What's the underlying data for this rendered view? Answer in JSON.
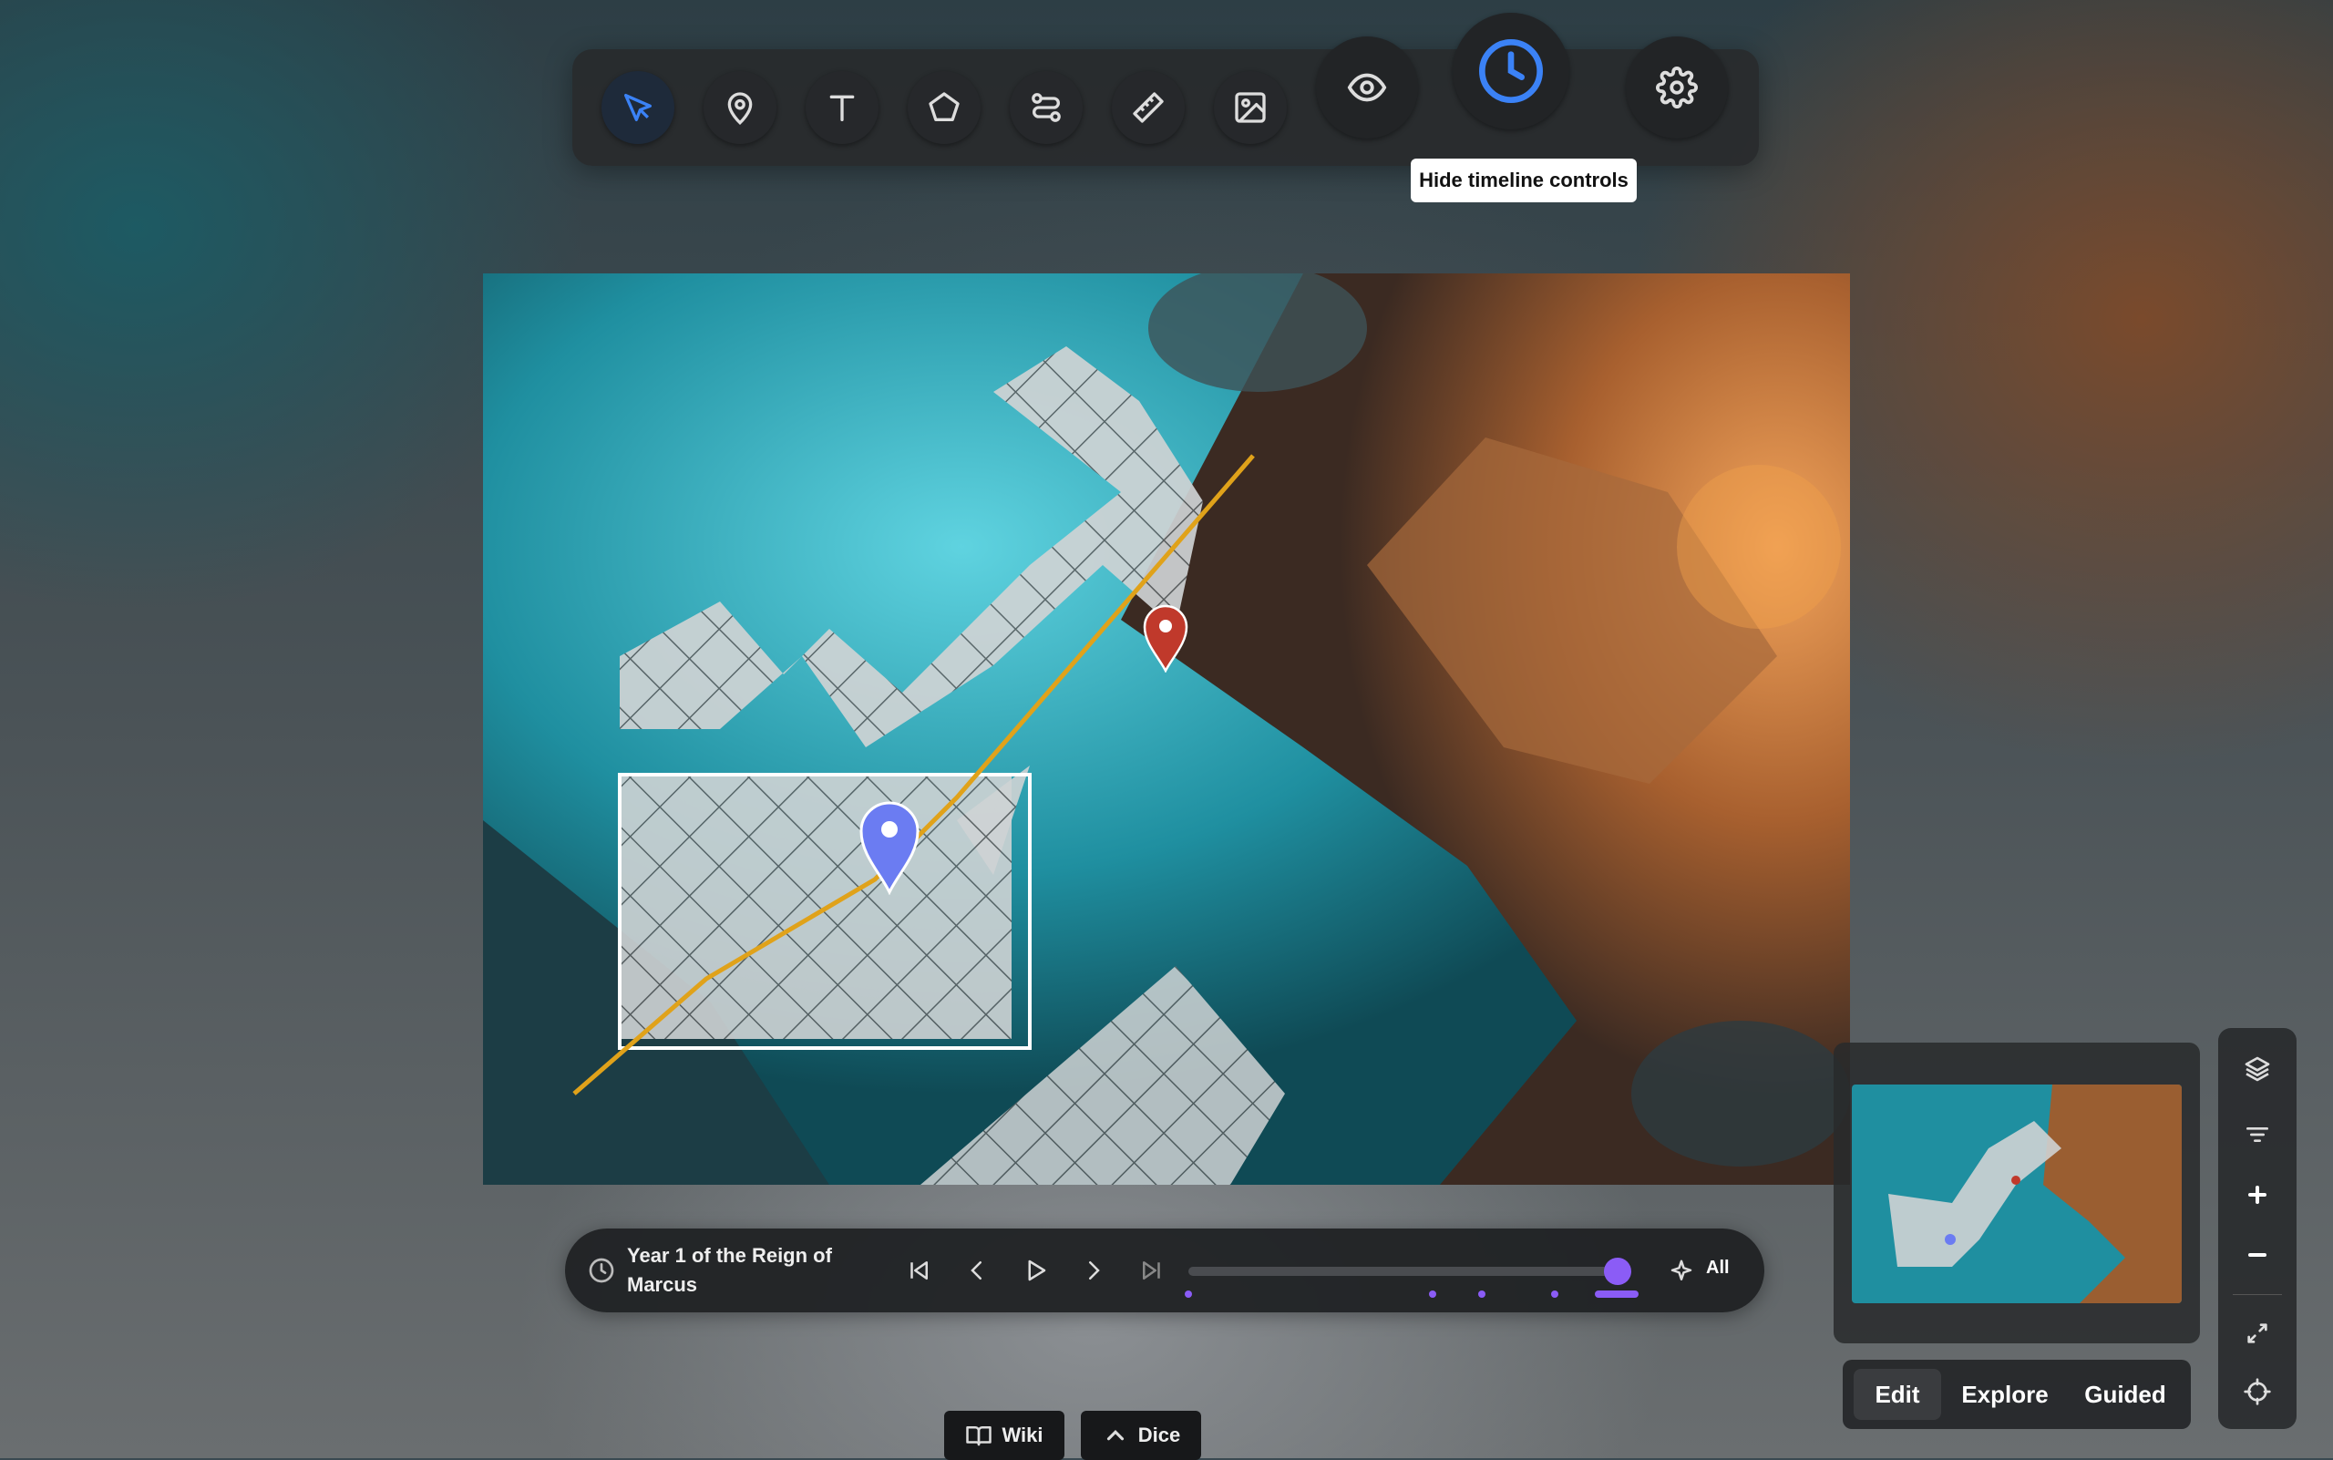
{
  "toolbar": {
    "tools": [
      {
        "name": "select-tool",
        "icon": "pointer-icon",
        "active": true
      },
      {
        "name": "marker-tool",
        "icon": "map-pin-icon"
      },
      {
        "name": "text-tool",
        "icon": "text-icon"
      },
      {
        "name": "polygon-tool",
        "icon": "pentagon-icon"
      },
      {
        "name": "path-tool",
        "icon": "route-icon"
      },
      {
        "name": "measure-tool",
        "icon": "ruler-icon"
      },
      {
        "name": "image-tool",
        "icon": "image-icon"
      }
    ],
    "visibility_icon": "eye-icon",
    "timeline_toggle_icon": "clock-icon",
    "settings_icon": "gear-icon",
    "tooltip": "Hide timeline controls",
    "accent_color": "#3b82f6"
  },
  "map": {
    "markers": [
      {
        "name": "red-marker",
        "color": "#c0392b"
      },
      {
        "name": "blue-marker",
        "color": "#6b7cf2"
      }
    ],
    "path_color": "#e0a21a",
    "selection_color": "#ffffff"
  },
  "timeline": {
    "title": "Year 1 of the Reign of Marcus",
    "clock_icon": "clock-icon",
    "controls": [
      "skip-back-icon",
      "chevron-left-icon",
      "play-icon",
      "chevron-right-icon",
      "skip-forward-icon"
    ],
    "all_label": "All",
    "sparkle_icon": "sparkle-icon",
    "accent_color": "#8b5cf6",
    "progress": 0.97
  },
  "modes": {
    "items": [
      "Edit",
      "Explore",
      "Guided"
    ],
    "active": "Edit"
  },
  "sidebar": {
    "buttons": [
      "layers-icon",
      "filter-icon",
      "zoom-in-icon",
      "zoom-out-icon",
      "fullscreen-icon",
      "locate-icon"
    ]
  },
  "bottom": {
    "wiki_label": "Wiki",
    "dice_label": "Dice"
  }
}
